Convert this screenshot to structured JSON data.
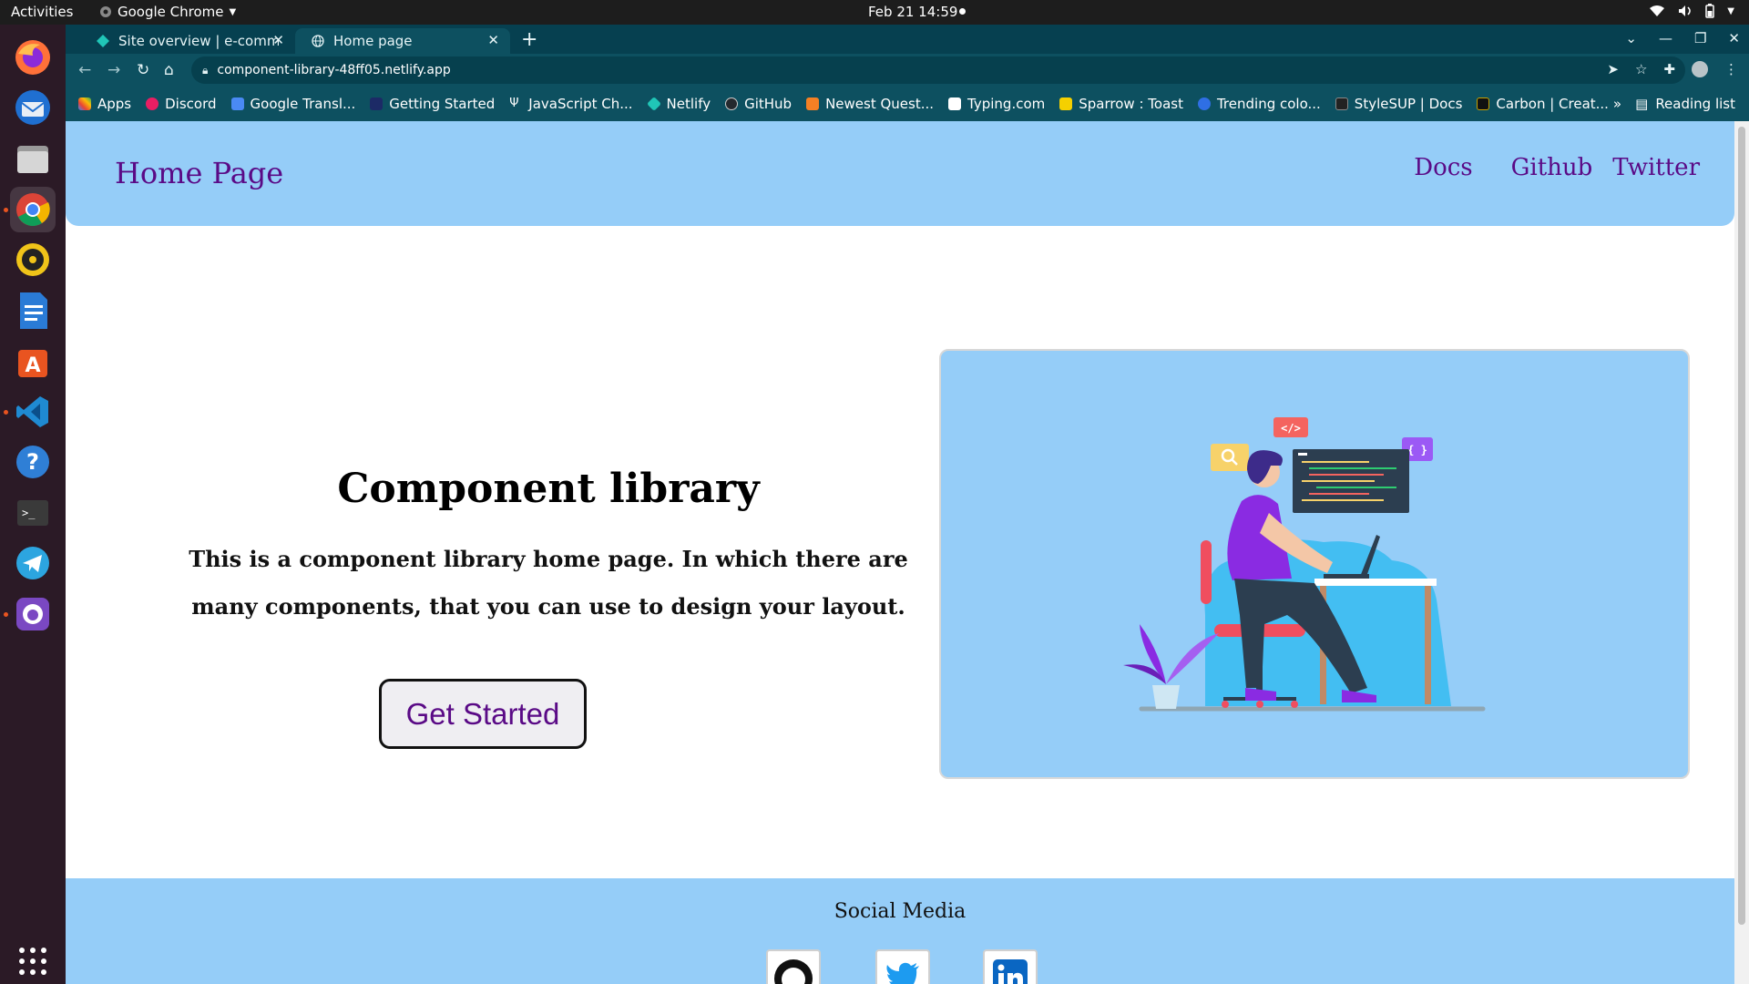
{
  "system_bar": {
    "activities": "Activities",
    "app_name": "Google Chrome",
    "clock": "Feb 21  14:59"
  },
  "browser": {
    "tabs": [
      {
        "title": "Site overview | e-commer",
        "active": false
      },
      {
        "title": "Home page",
        "active": true
      }
    ],
    "url": "component-library-48ff05.netlify.app",
    "bookmarks": [
      {
        "label": "Apps",
        "color": "#4285f4"
      },
      {
        "label": "Discord",
        "color": "#e91e63"
      },
      {
        "label": "Google Transl...",
        "color": "#4a8af4"
      },
      {
        "label": "Getting Started",
        "color": "#1c2a66"
      },
      {
        "label": "JavaScript Ch...",
        "color": "#0d5060"
      },
      {
        "label": "Netlify",
        "color": "#20c6b7"
      },
      {
        "label": "GitHub",
        "color": "#24292e"
      },
      {
        "label": "Newest Quest...",
        "color": "#f48024"
      },
      {
        "label": "Typing.com",
        "color": "#ffffff"
      },
      {
        "label": "Sparrow : Toast",
        "color": "#f5d000"
      },
      {
        "label": "Trending colo...",
        "color": "#2f6fe4"
      },
      {
        "label": "StyleSUP | Docs",
        "color": "#222222"
      },
      {
        "label": "Carbon | Creat...",
        "color": "#111111"
      }
    ],
    "bookmarks_more": "»",
    "reading_list": "Reading list"
  },
  "page": {
    "brand": "Home Page",
    "nav_links": [
      "Docs",
      "Github",
      "Twitter"
    ],
    "hero": {
      "title": "Component library",
      "description": "This is a component library home page. In which there are many components, that you can use to design your layout.",
      "cta": "Get Started"
    },
    "illustration": {
      "code_tag": "</>",
      "braces": "{ }"
    },
    "footer": {
      "title": "Social Media",
      "icons": [
        "github-icon",
        "twitter-icon",
        "linkedin-icon"
      ]
    }
  },
  "colors": {
    "nav_bg": "#95cdf8",
    "brand_purple": "#5a0a86",
    "chrome_frame": "#0d5060"
  }
}
